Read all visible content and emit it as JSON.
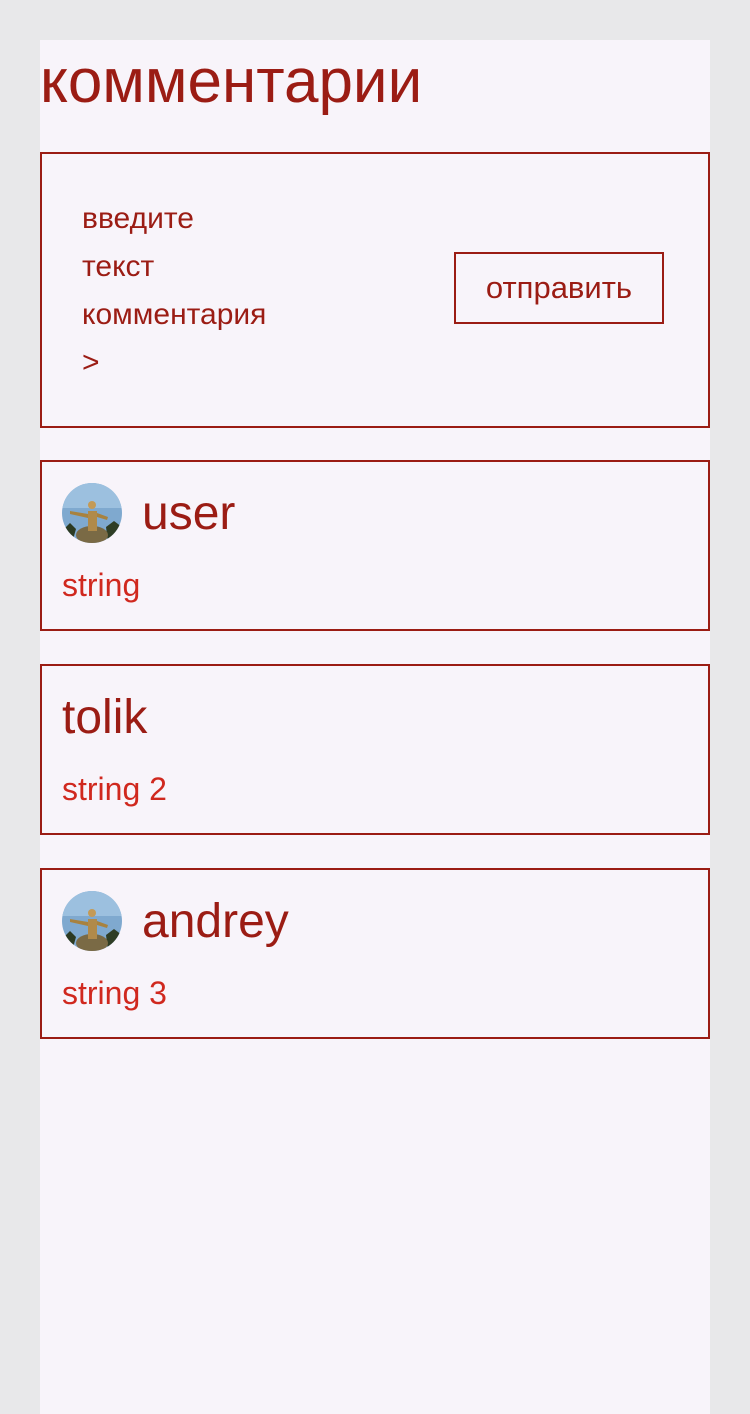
{
  "page": {
    "title": "комментарии"
  },
  "composer": {
    "input_text": "введите\nтекст\nкомментария\n>",
    "send_label": "отправить"
  },
  "comments": [
    {
      "author": "user",
      "text": "string",
      "has_avatar": true,
      "avatar_icon": "avatar-photo-statue"
    },
    {
      "author": "tolik",
      "text": "string 2",
      "has_avatar": false
    },
    {
      "author": "andrey",
      "text": "string 3",
      "has_avatar": true,
      "avatar_icon": "avatar-photo-statue"
    }
  ],
  "colors": {
    "page_background": "#e8e8ea",
    "panel_background": "#f8f4fa",
    "accent": "#9b1c14",
    "comment_text": "#d0281e"
  }
}
